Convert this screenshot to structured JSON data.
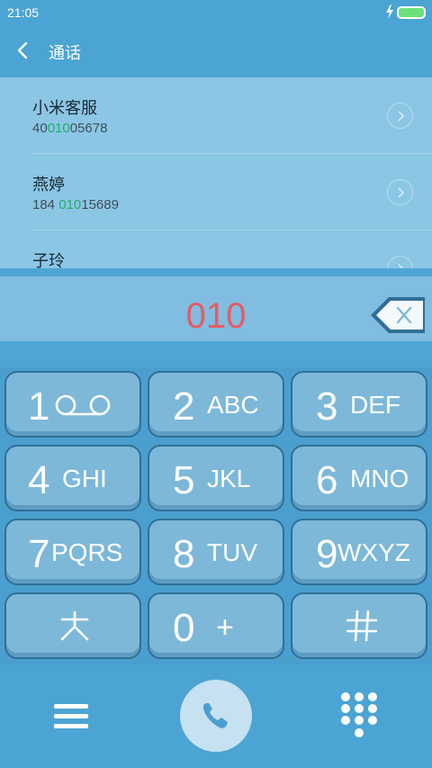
{
  "status_bar": {
    "time": "21:05"
  },
  "header": {
    "title": "通话"
  },
  "search_results": [
    {
      "name": "小米客服",
      "number_pre": "40",
      "number_match": "010",
      "number_post": "05678"
    },
    {
      "name": "燕婷",
      "number_pre": "184 ",
      "number_match": "010",
      "number_post": "15689"
    },
    {
      "name": "子玲",
      "number_pre": "",
      "number_match": "",
      "number_post": ""
    }
  ],
  "dial_input": {
    "value": "010"
  },
  "keypad": {
    "k1": {
      "digit": "1"
    },
    "k2": {
      "digit": "2",
      "letters": "ABC"
    },
    "k3": {
      "digit": "3",
      "letters": "DEF"
    },
    "k4": {
      "digit": "4",
      "letters": "GHI"
    },
    "k5": {
      "digit": "5",
      "letters": "JKL"
    },
    "k6": {
      "digit": "6",
      "letters": "MNO"
    },
    "k7": {
      "digit": "7",
      "letters": "PQRS"
    },
    "k8": {
      "digit": "8",
      "letters": "TUV"
    },
    "k9": {
      "digit": "9",
      "letters": "WXYZ"
    },
    "star": {
      "symbol": "✳"
    },
    "k0": {
      "digit": "0",
      "letters": "+"
    },
    "hash": {
      "symbol": "#"
    }
  },
  "colors": {
    "accent": "#4ba4d3",
    "highlight": "#1fb06b",
    "input_text": "#e65c63"
  },
  "icons": [
    "back-icon",
    "bolt-icon",
    "battery-icon",
    "chevron-right-icon",
    "backspace-icon",
    "voicemail-icon",
    "menu-icon",
    "phone-icon",
    "dialpad-icon"
  ]
}
